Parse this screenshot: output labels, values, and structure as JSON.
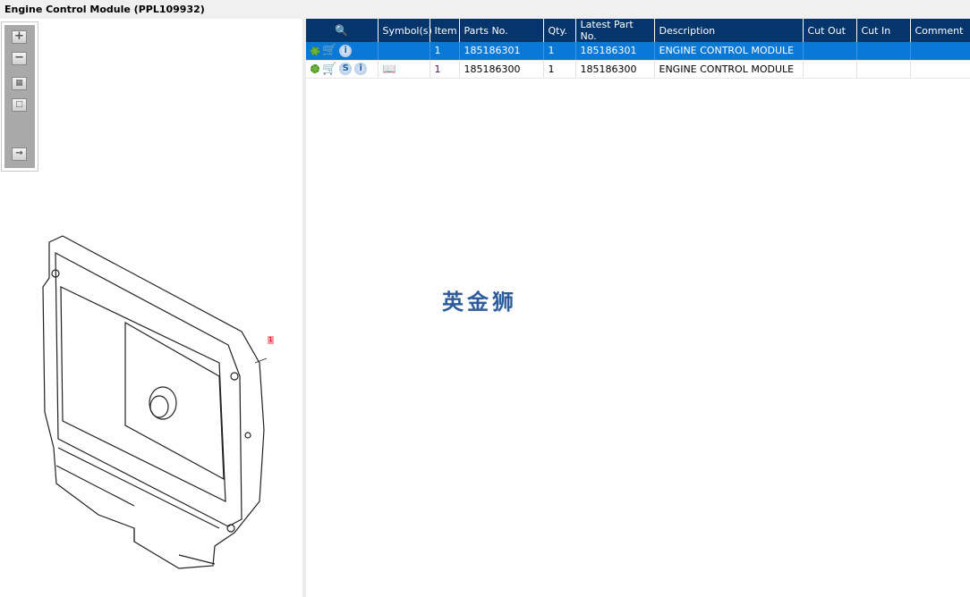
{
  "window": {
    "title": "Engine Control Module (PPL109932)"
  },
  "toolbox": {
    "zoom_in": "+",
    "zoom_out": "−"
  },
  "diagram": {
    "callout": "1"
  },
  "table": {
    "columns": [
      "",
      "Symbol(s)",
      "Item",
      "Parts No.",
      "Qty.",
      "Latest Part No.",
      "Description",
      "Cut Out",
      "Cut In",
      "Comment"
    ],
    "rows": [
      {
        "item": "1",
        "parts_no": "185186301",
        "qty": "1",
        "latest": "185186301",
        "description": "ENGINE CONTROL MODULE",
        "cut_out": "",
        "cut_in": "",
        "comment": "",
        "selected": true
      },
      {
        "item": "1",
        "parts_no": "185186300",
        "qty": "1",
        "latest": "185186300",
        "description": "ENGINE CONTROL MODULE",
        "cut_out": "",
        "cut_in": "",
        "comment": "",
        "selected": false
      }
    ]
  },
  "watermark": "英金狮",
  "colors": {
    "header": "#06356b",
    "selected": "#0a78d7"
  }
}
